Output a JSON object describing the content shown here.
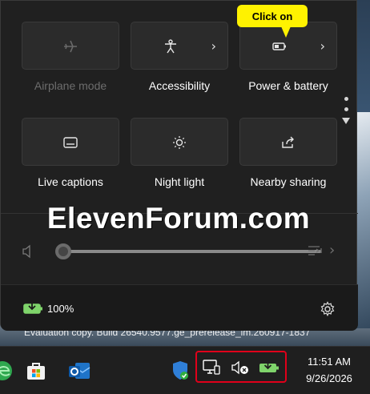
{
  "callout": {
    "text": "Click on"
  },
  "quick_settings": {
    "tiles": [
      {
        "label": "Airplane mode",
        "icon": "airplane-icon",
        "disabled": true,
        "has_chevron": false
      },
      {
        "label": "Accessibility",
        "icon": "accessibility-icon",
        "disabled": false,
        "has_chevron": true
      },
      {
        "label": "Power & battery",
        "icon": "battery-icon",
        "disabled": false,
        "has_chevron": true
      },
      {
        "label": "Live captions",
        "icon": "captions-icon",
        "disabled": false,
        "has_chevron": false
      },
      {
        "label": "Night light",
        "icon": "night-light-icon",
        "disabled": false,
        "has_chevron": false
      },
      {
        "label": "Nearby sharing",
        "icon": "share-icon",
        "disabled": false,
        "has_chevron": false
      }
    ],
    "volume": {
      "level": 0
    },
    "battery": {
      "percent_label": "100%"
    }
  },
  "watermark": {
    "brand": "ElevenForum.com",
    "evaluation_line": "Evaluation copy. Build 26540.9577.ge_prerelease_im.260917-1837"
  },
  "taskbar": {
    "time": "11:51 AM",
    "date": "9/26/2026"
  },
  "colors": {
    "accent_yellow": "#fff200",
    "highlight_red": "#e0001a",
    "battery_green": "#7fd46b",
    "panel": "#202020"
  }
}
